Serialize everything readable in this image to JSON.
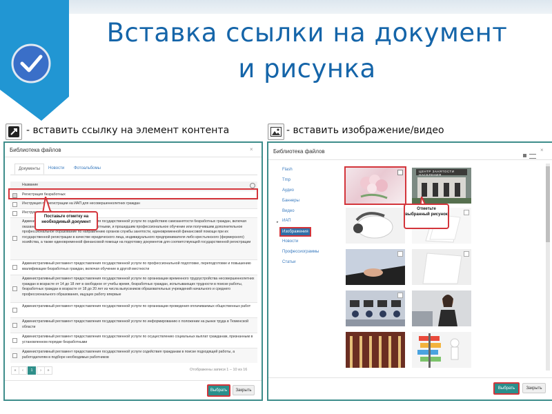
{
  "slide": {
    "title_line1": "Вставка ссылки на документ",
    "title_line2": "и рисунка",
    "caption_left": "- вставить ссылку на элемент контента",
    "caption_right": "- вставить изображение/видео"
  },
  "left_dialog": {
    "title": "Библиотека файлов",
    "close": "×",
    "tabs": [
      "Документы",
      "Новости",
      "Фотоальбомы"
    ],
    "column_header": "Название",
    "rows": [
      "Регистрация безработных",
      "Инструкция по регистрации на ИАП для несовершеннолетних граждан",
      "Инструкция ... работодателей",
      "Административный регламент предоставления государственной услуги по содействию самозанятости безработных граждан, включая оказание ... в установленном порядке безработными, и прошедшим профессиональное обучение или получившим дополнительное профессиональное образование по направлению органов службы занятости, единовременной финансовой помощи при их государственной регистрации в качестве юридического лица, индивидуального предпринимателя либо крестьянского (фермерского) хозяйства, а также единовременной финансовой помощи на подготовку документов для соответствующей государственной регистрации",
      "Административный регламент предоставления государственной услуги по профессиональной подготовке, переподготовке и повышению квалификации безработных граждан, включая обучение в другой местности",
      "Административный регламент предоставления государственной услуги по организации временного трудоустройства несовершеннолетних граждан в возрасте от 14 до 18 лет в свободное от учебы время, безработных граждан, испытывающих трудности в поиске работы, безработных граждан в возрасте от 18 до 20 лет из числа выпускников образовательных учреждений начального и среднего профессионального образования, ищущих работу впервые",
      "Административный регламент предоставления государственной услуги по организации проведения оплачиваемых общественных работ",
      "Административный регламент предоставления государственной услуги по информированию о положении на рынке труда в Тюменской области",
      "Административный регламент предоставления государственной услуги по осуществлению социальных выплат гражданам, признанным в установленном порядке безработными",
      "Административный регламент предоставления государственной услуги содействия гражданам в поиске подходящей работы, а работодателям в подборе необходимых работников"
    ],
    "callout": "Поставьте отметку на необходимый документ",
    "pager": {
      "first": "«",
      "prev": "‹",
      "current": "1",
      "next": "›",
      "last": "»"
    },
    "records_info": "Отображены записи 1 – 10 из 16",
    "select_button": "Выбрать",
    "close_button": "Закрыть"
  },
  "right_dialog": {
    "title": "Библиотека файлов",
    "close": "×",
    "categories": [
      "Flash",
      "Tmp",
      "Аудио",
      "Баннеры",
      "Видео",
      "ИАП",
      "Изображения",
      "Новости",
      "Профессиограммы",
      "Статьи"
    ],
    "active_category": "Изображения",
    "callout": "Отметьте выбранный рисунок",
    "sign_text": "ЦЕНТР ЗАНЯТОСТИ НАСЕЛЕНИЯ",
    "select_button": "Выбрать",
    "close_button": "Закрыть"
  },
  "colors": {
    "title": "#1565a9",
    "badge": "#2196d3",
    "dialog_border": "#3c8c8a",
    "highlight": "#d3343a",
    "primary_button": "#2a8f8c"
  }
}
